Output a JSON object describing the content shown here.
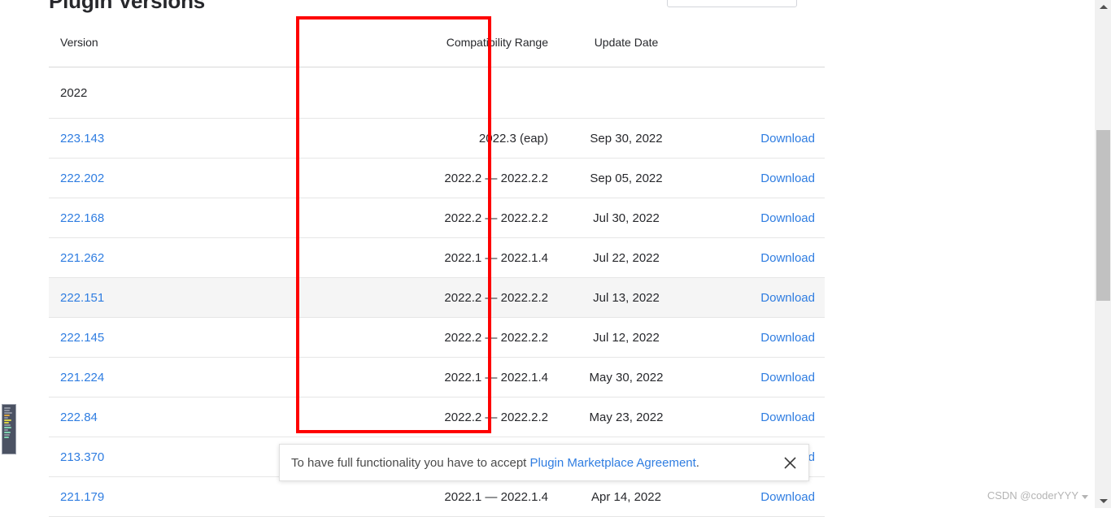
{
  "page": {
    "title": "Plugin Versions"
  },
  "filter": {
    "label": "",
    "value": ""
  },
  "table": {
    "columns": [
      {
        "key": "version",
        "label": "Version"
      },
      {
        "key": "range",
        "label": "Compatibility Range"
      },
      {
        "key": "date",
        "label": "Update Date"
      },
      {
        "key": "action",
        "label": ""
      }
    ],
    "year_group": "2022",
    "action_label": "Download",
    "rows": [
      {
        "version": "223.143",
        "range": "2022.3 (eap)",
        "date": "Sep 30, 2022",
        "action": "Download",
        "highlight": false
      },
      {
        "version": "222.202",
        "range": "2022.2 — 2022.2.2",
        "date": "Sep 05, 2022",
        "action": "Download",
        "highlight": false
      },
      {
        "version": "222.168",
        "range": "2022.2 — 2022.2.2",
        "date": "Jul 30, 2022",
        "action": "Download",
        "highlight": false
      },
      {
        "version": "221.262",
        "range": "2022.1 — 2022.1.4",
        "date": "Jul 22, 2022",
        "action": "Download",
        "highlight": false
      },
      {
        "version": "222.151",
        "range": "2022.2 — 2022.2.2",
        "date": "Jul 13, 2022",
        "action": "Download",
        "highlight": true
      },
      {
        "version": "222.145",
        "range": "2022.2 — 2022.2.2",
        "date": "Jul 12, 2022",
        "action": "Download",
        "highlight": false
      },
      {
        "version": "221.224",
        "range": "2022.1 — 2022.1.4",
        "date": "May 30, 2022",
        "action": "Download",
        "highlight": false
      },
      {
        "version": "222.84",
        "range": "2022.2 — 2022.2.2",
        "date": "May 23, 2022",
        "action": "Download",
        "highlight": false
      },
      {
        "version": "213.370",
        "range": "",
        "date": "",
        "action": "Download",
        "highlight": false
      },
      {
        "version": "221.179",
        "range": "2022.1 — 2022.1.4",
        "date": "Apr 14, 2022",
        "action": "Download",
        "highlight": false
      }
    ]
  },
  "annotation": {
    "color": "#fe0000",
    "target_column": "Compatibility Range"
  },
  "notice": {
    "text_before": "To have full functionality you have to accept ",
    "link_text": "Plugin Marketplace Agreement",
    "text_after": ".",
    "close_icon": "close-icon"
  },
  "scrollbar": {
    "up_icon": "chevron-up-icon",
    "down_icon": "chevron-down-icon"
  },
  "watermark": {
    "text": "CSDN @coderYYY"
  },
  "colors": {
    "link": "#2f7de1",
    "annotation": "#fe0000",
    "row_highlight": "#f5f5f5",
    "text": "#27282c"
  }
}
